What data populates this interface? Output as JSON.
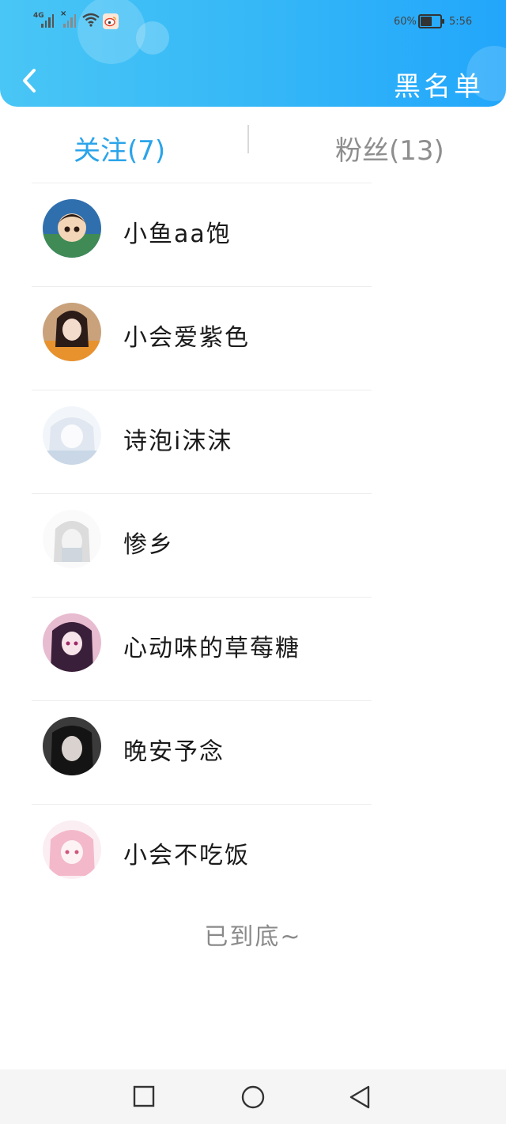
{
  "status_bar": {
    "network": "4G",
    "battery_percent": "60%",
    "battery_level": 0.6,
    "time": "5:56"
  },
  "header": {
    "title": "黑名单",
    "back_icon": "chevron-left-icon",
    "colors": {
      "gradient_start": "#49c6f5",
      "gradient_end": "#22a6fb"
    }
  },
  "tabs": [
    {
      "label": "关注(7)",
      "active": true,
      "color": "#2aa4ea"
    },
    {
      "label": "粉丝(13)",
      "active": false,
      "color": "#8e8e8e"
    }
  ],
  "list": {
    "items": [
      {
        "name": "小鱼aa饱",
        "avatar": "avatar-icon"
      },
      {
        "name": "小会爱紫色",
        "avatar": "avatar-icon"
      },
      {
        "name": "诗泡i沫沫",
        "avatar": "avatar-icon"
      },
      {
        "name": "惨乡",
        "avatar": "avatar-icon"
      },
      {
        "name": "心动味的草莓糖",
        "avatar": "avatar-icon"
      },
      {
        "name": "晚安予念",
        "avatar": "avatar-icon"
      },
      {
        "name": "小会不吃饭",
        "avatar": "avatar-icon"
      }
    ],
    "end_text": "已到底~"
  },
  "nav_bar": {
    "icons": [
      "square-recent-icon",
      "circle-home-icon",
      "triangle-back-icon"
    ]
  }
}
